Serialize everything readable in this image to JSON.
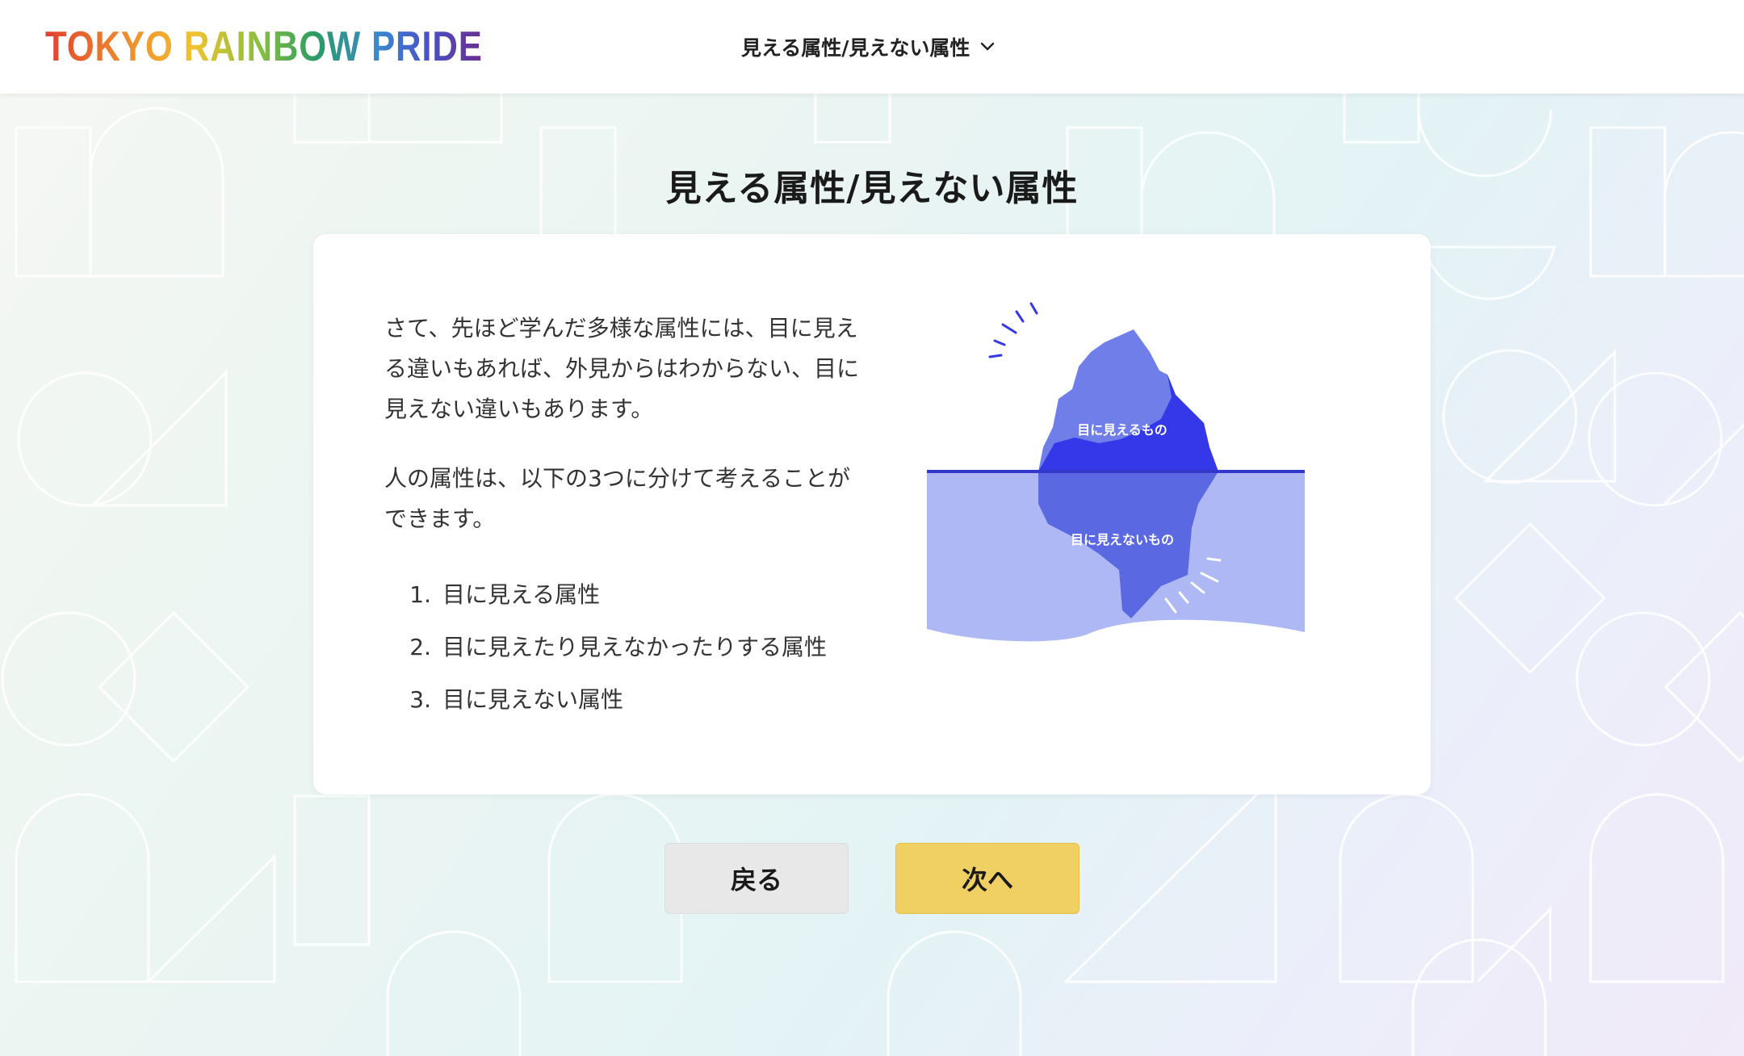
{
  "header": {
    "logo_text": "TOKYO RAINBOW PRIDE",
    "nav_label": "見える属性/見えない属性",
    "nav_icon": "chevron-down-icon"
  },
  "main": {
    "title": "見える属性/見えない属性",
    "paragraph1": "さて、先ほど学んだ多様な属性には、目に見える違いもあれば、外見からはわからない、目に見えない違いもあります。",
    "paragraph2": "人の属性は、以下の3つに分けて考えることができます。",
    "list": [
      {
        "num": "1.",
        "text": "目に見える属性"
      },
      {
        "num": "2.",
        "text": "目に見えたり見えなかったりする属性"
      },
      {
        "num": "3.",
        "text": "目に見えない属性"
      }
    ],
    "illustration": {
      "above_label": "目に見えるもの",
      "below_label": "目に見えないもの"
    }
  },
  "buttons": {
    "back_label": "戻る",
    "next_label": "次へ"
  },
  "colors": {
    "accent_yellow": "#f0d062",
    "iceberg_blue": "#3438e8",
    "iceberg_light": "#6f7ee9",
    "water": "#aeb8f4"
  }
}
